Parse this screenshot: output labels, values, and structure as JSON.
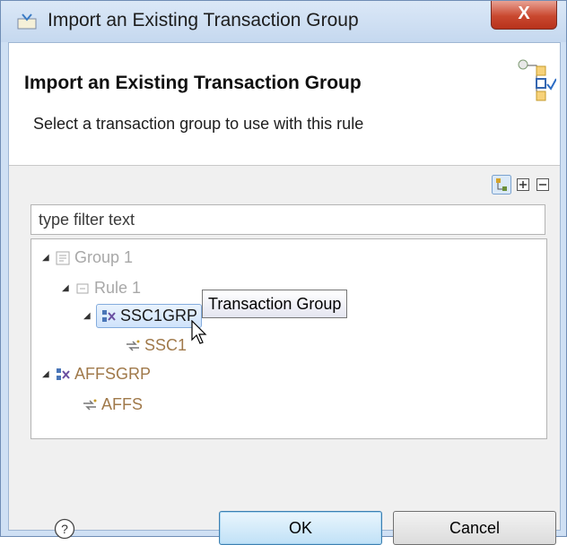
{
  "window": {
    "title": "Import an Existing Transaction Group",
    "close_label": "X"
  },
  "banner": {
    "title": "Import an Existing Transaction Group",
    "description": "Select a transaction group to use with this rule"
  },
  "filter": {
    "placeholder": "type filter text"
  },
  "tree": {
    "group": "Group 1",
    "rule": "Rule 1",
    "tg_selected": "SSC1GRP",
    "tg_selected_child": "SSC1",
    "tg2": "AFFSGRP",
    "tg2_child": "AFFS"
  },
  "tooltip": "Transaction Group",
  "buttons": {
    "help": "?",
    "ok": "OK",
    "cancel": "Cancel"
  },
  "colors": {
    "selection": "#cfe3fb",
    "inactive_text": "#a8a8a8",
    "node_text": "#a0794a",
    "close_button": "#c9482f"
  }
}
